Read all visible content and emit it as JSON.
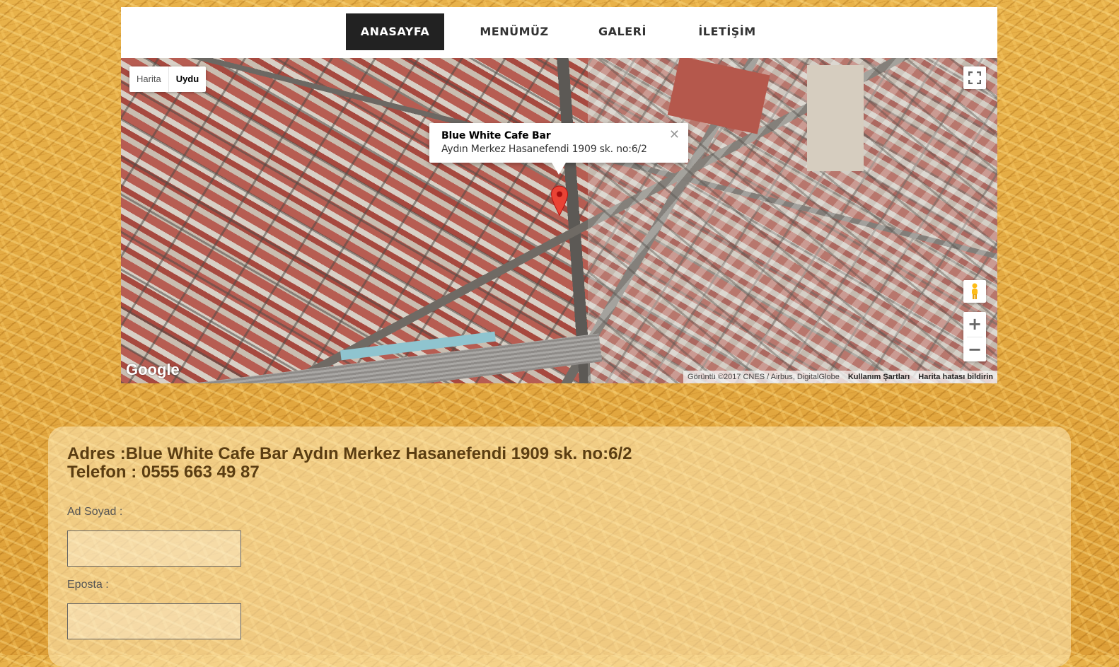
{
  "nav": {
    "items": [
      {
        "label": "ANASAYFA",
        "active": true
      },
      {
        "label": "MENÜMÜZ"
      },
      {
        "label": "GALERİ"
      },
      {
        "label": "İLETİŞİM"
      }
    ]
  },
  "map": {
    "type_toggle": {
      "map_label": "Harita",
      "satellite_label": "Uydu",
      "selected": "Uydu"
    },
    "infowindow": {
      "title": "Blue White Cafe Bar",
      "address": "Aydın Merkez Hasanefendi 1909 sk. no:6/2"
    },
    "logo": "Google",
    "attribution": {
      "imagery": "Görüntü ©2017 CNES / Airbus, DigitalGlobe",
      "terms": "Kullanım Şartları",
      "report": "Harita hatası bildirin"
    },
    "icons": {
      "fullscreen": "fullscreen-icon",
      "pegman": "pegman-icon",
      "zoom_in": "+",
      "zoom_out": "−",
      "marker": "map-pin-icon"
    },
    "marker_color": "#ea4335"
  },
  "contact": {
    "address_line": "Adres :Blue White Cafe Bar Aydın Merkez Hasanefendi 1909 sk. no:6/2",
    "phone_line": "Telefon : 0555 663 49 87",
    "fields": [
      {
        "label": "Ad Soyad :",
        "value": ""
      },
      {
        "label": "Eposta :",
        "value": ""
      }
    ]
  },
  "colors": {
    "nav_active_bg": "#222222",
    "info_text": "#5a3d12"
  }
}
